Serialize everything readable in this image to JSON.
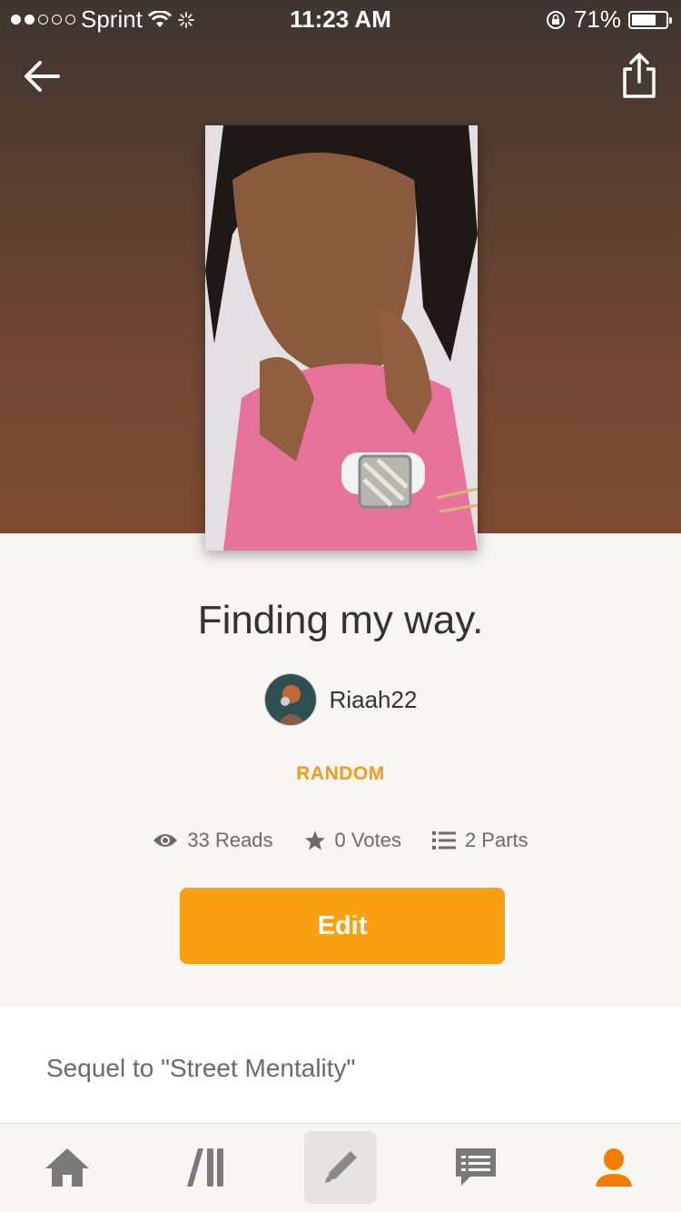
{
  "status_bar": {
    "carrier": "Sprint",
    "time": "11:23 AM",
    "battery": "71%",
    "battery_level": 0.71,
    "signal_bars_filled": 2,
    "signal_bars_total": 5
  },
  "story": {
    "title": "Finding my way.",
    "author": "Riaah22",
    "category": "RANDOM",
    "stats": {
      "reads": "33 Reads",
      "votes": "0 Votes",
      "parts": "2 Parts"
    },
    "edit_label": "Edit",
    "description": "Sequel to \"Street Mentality\""
  },
  "tabbar": {
    "items": [
      {
        "name": "home",
        "icon": "home-icon"
      },
      {
        "name": "library",
        "icon": "library-icon"
      },
      {
        "name": "write",
        "icon": "pencil-icon",
        "active": true
      },
      {
        "name": "messages",
        "icon": "chat-icon"
      },
      {
        "name": "profile",
        "icon": "profile-icon",
        "highlight": "#f57c00"
      }
    ]
  },
  "colors": {
    "accent": "#fa9e12",
    "category": "#f59a14",
    "profile_active": "#f57c00"
  }
}
